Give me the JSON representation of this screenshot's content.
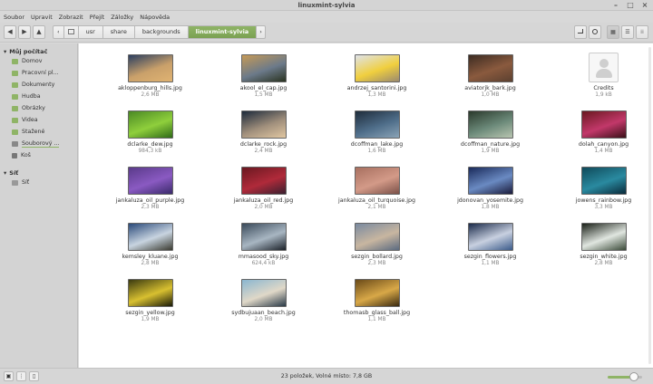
{
  "window": {
    "title": "linuxmint-sylvia",
    "controls": [
      "–",
      "□",
      "×"
    ]
  },
  "menu": [
    "Soubor",
    "Upravit",
    "Zobrazit",
    "Přejít",
    "Záložky",
    "Nápověda"
  ],
  "toolbar": {
    "nav": [
      "◀",
      "▶",
      "▲"
    ],
    "crumb_prev": "‹",
    "crumb_next": "›",
    "breadcrumbs": [
      "usr",
      "share",
      "backgrounds",
      "linuxmint-sylvia"
    ],
    "active_crumb": "linuxmint-sylvia"
  },
  "sidebar": {
    "sections": [
      {
        "title": "Můj počítač",
        "items": [
          {
            "label": "Domov",
            "icon": "home-folder-icon"
          },
          {
            "label": "Pracovní pl...",
            "icon": "desktop-folder-icon"
          },
          {
            "label": "Dokumenty",
            "icon": "documents-folder-icon"
          },
          {
            "label": "Hudba",
            "icon": "music-folder-icon"
          },
          {
            "label": "Obrázky",
            "icon": "pictures-folder-icon"
          },
          {
            "label": "Videa",
            "icon": "videos-folder-icon"
          },
          {
            "label": "Stažené",
            "icon": "downloads-folder-icon"
          },
          {
            "label": "Souborový ...",
            "icon": "filesystem-drive-icon"
          },
          {
            "label": "Koš",
            "icon": "trash-icon"
          }
        ]
      },
      {
        "title": "Síť",
        "items": [
          {
            "label": "Síť",
            "icon": "network-icon"
          }
        ]
      }
    ]
  },
  "files": [
    {
      "name": "akloppenburg_hills.jpg",
      "size": "2,6 MB",
      "colors": [
        "#2b3f60",
        "#c9a06a",
        "#e0b372"
      ]
    },
    {
      "name": "akool_el_cap.jpg",
      "size": "1,5 MB",
      "colors": [
        "#c59a57",
        "#6c7a8a",
        "#2a3320"
      ]
    },
    {
      "name": "andrzej_santorini.jpg",
      "size": "1,3 MB",
      "colors": [
        "#dfe3ea",
        "#f0cf3e",
        "#9a8a70"
      ]
    },
    {
      "name": "aviatorjk_bark.jpg",
      "size": "1,0 MB",
      "colors": [
        "#3d2c22",
        "#8a5a3e",
        "#5b4030"
      ]
    },
    {
      "name": "Credits",
      "size": "1,9 kB",
      "colors": []
    },
    {
      "name": "dclarke_dew.jpg",
      "size": "984,3 kB",
      "colors": [
        "#4b8a24",
        "#8fcf3c",
        "#2f6a18"
      ]
    },
    {
      "name": "dclarke_rock.jpg",
      "size": "2,4 MB",
      "colors": [
        "#1d2a3b",
        "#a08f7c",
        "#e1c7a1"
      ]
    },
    {
      "name": "dcoffman_lake.jpg",
      "size": "1,6 MB",
      "colors": [
        "#1f2d3c",
        "#4f6e8a",
        "#8aa3b6"
      ]
    },
    {
      "name": "dcoffman_nature.jpg",
      "size": "1,9 MB",
      "colors": [
        "#2b3a2c",
        "#6c8a7a",
        "#b8c5b0"
      ]
    },
    {
      "name": "dolah_canyon.jpg",
      "size": "1,4 MB",
      "colors": [
        "#6a1820",
        "#c2386a",
        "#3a1018"
      ]
    },
    {
      "name": "jankaluza_oil_purple.jpg",
      "size": "2,3 MB",
      "colors": [
        "#5a3a8a",
        "#8a5ac2",
        "#3a2a6a"
      ]
    },
    {
      "name": "jankaluza_oil_red.jpg",
      "size": "2,0 MB",
      "colors": [
        "#6a1820",
        "#b02a3a",
        "#3a2030"
      ]
    },
    {
      "name": "jankaluza_oil_turquoise.jpg",
      "size": "2,1 MB",
      "colors": [
        "#a87060",
        "#d39a88",
        "#7a5048"
      ]
    },
    {
      "name": "jdonovan_yosemite.jpg",
      "size": "1,8 MB",
      "colors": [
        "#1a2a5a",
        "#6a8ac2",
        "#1a1a3a"
      ]
    },
    {
      "name": "jowens_rainbow.jpg",
      "size": "3,3 MB",
      "colors": [
        "#0f4a5a",
        "#2a8aa0",
        "#0a2a3a"
      ]
    },
    {
      "name": "kemsley_kluane.jpg",
      "size": "2,8 MB",
      "colors": [
        "#2a4a7a",
        "#c8d4e0",
        "#3a3a30"
      ]
    },
    {
      "name": "mmasood_sky.jpg",
      "size": "624,4 kB",
      "colors": [
        "#3a4a5a",
        "#a8b6c2",
        "#1a2028"
      ]
    },
    {
      "name": "sezgin_bollard.jpg",
      "size": "2,3 MB",
      "colors": [
        "#7a8aa0",
        "#c8b6a0",
        "#5a6a80"
      ]
    },
    {
      "name": "sezgin_flowers.jpg",
      "size": "1,1 MB",
      "colors": [
        "#1a2a4a",
        "#c8d0e0",
        "#3a5a8a"
      ]
    },
    {
      "name": "sezgin_white.jpg",
      "size": "2,8 MB",
      "colors": [
        "#1a2018",
        "#e0e6e0",
        "#3a4a38"
      ]
    },
    {
      "name": "sezgin_yellow.jpg",
      "size": "1,9 MB",
      "colors": [
        "#3a3a10",
        "#d8c030",
        "#1a1a08"
      ]
    },
    {
      "name": "sydbujuaan_beach.jpg",
      "size": "2,0 MB",
      "colors": [
        "#8ab6d0",
        "#e0d8c8",
        "#2a3a48"
      ]
    },
    {
      "name": "thomasb_glass_ball.jpg",
      "size": "1,1 MB",
      "colors": [
        "#6a4a18",
        "#d8a848",
        "#3a2a10"
      ]
    }
  ],
  "status": {
    "text": "23 položek, Volné místo: 7,8 GB"
  },
  "zoom_level": 0.85
}
